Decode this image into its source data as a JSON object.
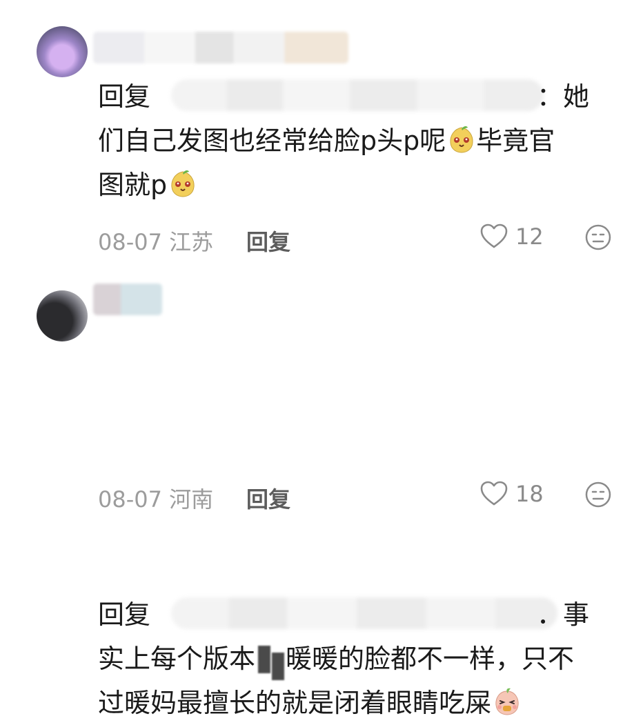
{
  "comments": [
    {
      "reply_prefix": "回复",
      "reply_tail": "：她",
      "line2": "们自己发图也经常给脸p头p呢",
      "line2_after_emoji": "毕竟官",
      "line3": "图就p",
      "emoji": "mango-face-emoji",
      "date": "08-07",
      "location": "江苏",
      "reply_label": "回复",
      "likes": "12"
    },
    {
      "reply_prefix": "回复",
      "reply_tail": "．事",
      "line2": "实上每个版本",
      "line2_b": "暖暖的脸都不一样，只不",
      "line3": "过暖妈最擅长的就是闭着眼睛吃屎",
      "emoji": "peach-face-emoji",
      "date": "08-07",
      "location": "河南",
      "reply_label": "回复",
      "likes": "18"
    }
  ],
  "colors": {
    "text": "#1a1a1a",
    "meta": "#9c9c9c",
    "reply_button": "#5c5c5c"
  }
}
